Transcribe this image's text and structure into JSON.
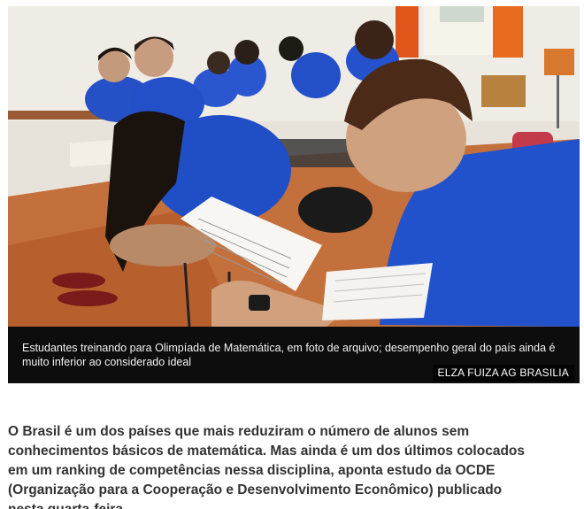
{
  "photo": {
    "alt": "Estudantes treinando para Olimpíada de Matemática",
    "credit": "ELZA FUIZA AG BRASILIA"
  },
  "caption": "Estudantes treinando para Olimpíada de Matemática, em foto de arquivo; desempenho geral do país ainda é muito inferior ao considerado ideal",
  "article": {
    "paragraph": "O Brasil é um dos países que mais reduziram o número de alunos sem conhecimentos básicos de matemática. Mas ainda é um dos últimos colocados em um ranking de competências nessa disciplina, aponta estudo da OCDE (Organização para a Cooperação e Desenvolvimento Econômico) publicado nesta quarta-feira."
  },
  "colors": {
    "caption_bg": "#0d0d0d",
    "shirt_blue": "#1f4fc4",
    "article_text": "#333333"
  }
}
